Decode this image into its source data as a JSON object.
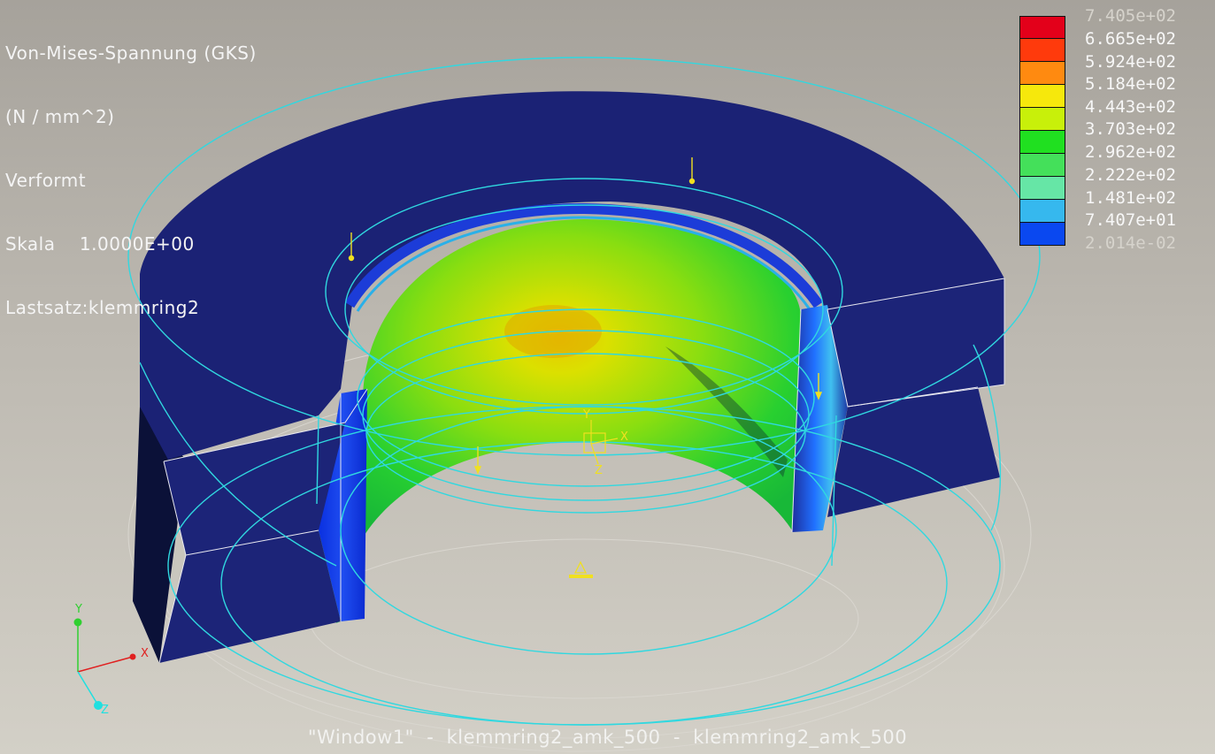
{
  "result_header": {
    "lines": [
      "Von-Mises-Spannung (GKS)",
      "(N / mm^2)",
      "Verformt",
      "Skala    1.0000E+00",
      "Lastsatz:klemmring2"
    ]
  },
  "legend": {
    "labels": [
      "7.405e+02",
      "6.665e+02",
      "5.924e+02",
      "5.184e+02",
      "4.443e+02",
      "3.703e+02",
      "2.962e+02",
      "2.222e+02",
      "1.481e+02",
      "7.407e+01",
      "2.014e-02"
    ],
    "colors": [
      "#e3001a",
      "#ff3a0c",
      "#ff8a10",
      "#f6e80c",
      "#c8f00a",
      "#20e020",
      "#44e05a",
      "#66e6a6",
      "#36b8ee",
      "#0a48f0",
      "#1a1a92"
    ]
  },
  "axes": {
    "x_label": "X",
    "y_label": "Y",
    "z_label": "Z",
    "x_color": "#e02020",
    "y_color": "#30d030",
    "z_color": "#20e0e0"
  },
  "origin_marker": {
    "x_label": "X",
    "y_label": "Y",
    "z_label": "Z",
    "color": "#f0e020"
  },
  "window_title": "\"Window1\"  -  klemmring2_amk_500  -  klemmring2_amk_500"
}
